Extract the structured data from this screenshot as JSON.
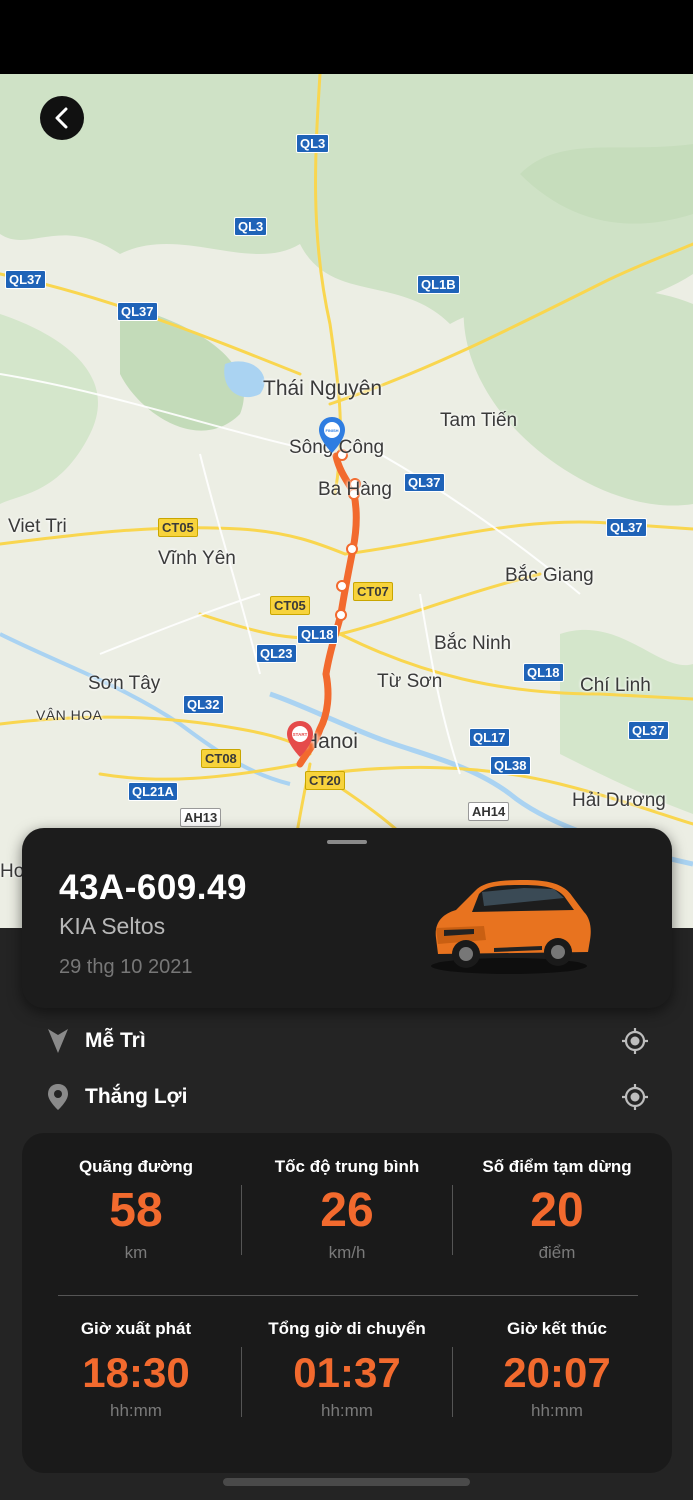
{
  "map": {
    "road_labels": [
      "QL3",
      "QL3",
      "QL37",
      "QL37",
      "QL1B",
      "QL37",
      "CT05",
      "CT07",
      "CT05",
      "QL18",
      "QL23",
      "QL32",
      "CT08",
      "CT20",
      "QL21A",
      "AH13",
      "AH14",
      "QL17",
      "QL38",
      "QL18",
      "QL37",
      "QL37"
    ],
    "places": [
      "Thái Nguyên",
      "Tam Tiến",
      "Sông Công",
      "Ba Hàng",
      "Viet Tri",
      "Vĩnh Yên",
      "Bắc Giang",
      "Bắc Ninh",
      "Sơn Tây",
      "Từ Sơn",
      "Chí Linh",
      "VÂN HOA",
      "Hanoi",
      "Hải Dương",
      "Hoa"
    ],
    "start_marker": "START",
    "finish_marker": "FINISH",
    "route_color": "#f26a2e"
  },
  "vehicle": {
    "plate": "43A-609.49",
    "model": "KIA Seltos",
    "date": "29  thg 10 2021",
    "car_color": "#e8731f"
  },
  "route": {
    "from": "Mễ Trì",
    "to": "Thắng Lợi"
  },
  "stats": {
    "distance": {
      "title": "Quãng đường",
      "value": "58",
      "unit": "km"
    },
    "avg_speed": {
      "title": "Tốc độ trung bình",
      "value": "26",
      "unit": "km/h"
    },
    "stops": {
      "title": "Số điểm tạm dừng",
      "value": "20",
      "unit": "điểm"
    },
    "start_time": {
      "title": "Giờ xuất phát",
      "value": "18:30",
      "unit": "hh:mm"
    },
    "total_time": {
      "title": "Tổng giờ di chuyển",
      "value": "01:37",
      "unit": "hh:mm"
    },
    "end_time": {
      "title": "Giờ kết thúc",
      "value": "20:07",
      "unit": "hh:mm"
    }
  },
  "colors": {
    "accent": "#f26a2e",
    "sheet_bg": "#242424",
    "card_bg": "#1a1a1a"
  }
}
